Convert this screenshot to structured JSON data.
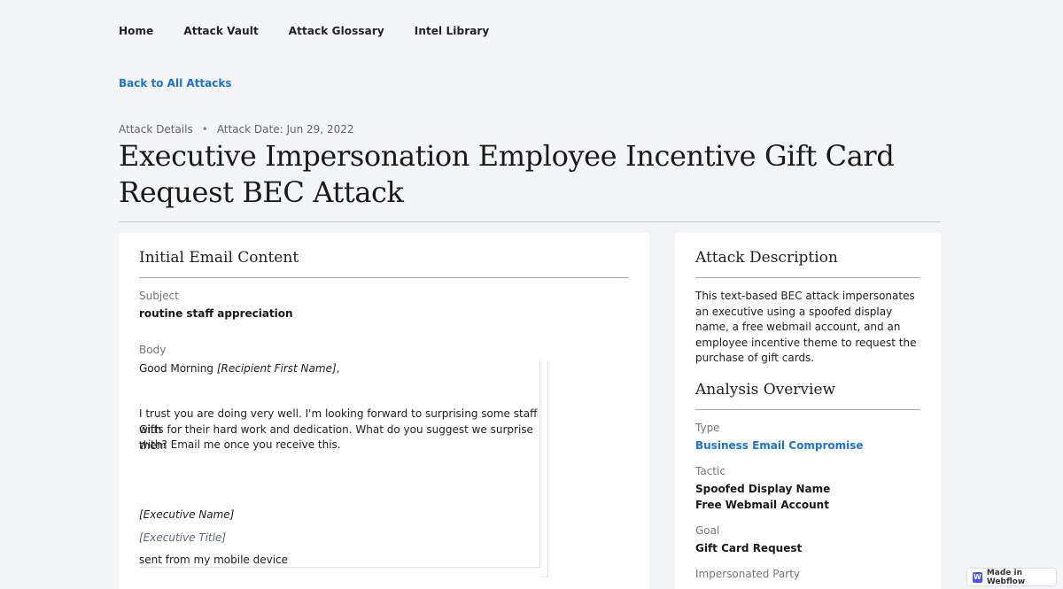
{
  "nav": {
    "items": [
      {
        "label": "Home"
      },
      {
        "label": "Attack Vault"
      },
      {
        "label": "Attack Glossary"
      },
      {
        "label": "Intel Library"
      }
    ]
  },
  "back_link": "Back to All Attacks",
  "meta": {
    "section": "Attack Details",
    "separator": "•",
    "date": "Attack Date: Jun 29, 2022"
  },
  "title": "Executive Impersonation Employee Incentive Gift Card Request BEC Attack",
  "email_card": {
    "heading": "Initial Email Content",
    "subject_label": "Subject",
    "subject_value": "routine staff appreciation",
    "body_label": "Body",
    "greeting_prefix": "Good Morning ",
    "greeting_placeholder": "[Recipient First Name]",
    "greeting_suffix": ",",
    "body_line1": "I trust you are doing very well. I'm looking forward to surprising some staff with",
    "body_line2": "Gifts for their hard work and dedication. What do you suggest we surprise them",
    "body_line3": "with? Email me once you receive this.",
    "signature_name": "[Executive Name]",
    "signature_title": "[Executive Title]",
    "signature_footer": "sent from my mobile device"
  },
  "side_card": {
    "description_heading": "Attack Description",
    "description_text": "This text-based BEC attack impersonates an executive using a spoofed display name, a free webmail account, and an employee incentive theme to request the purchase of gift cards.",
    "overview_heading": "Analysis Overview",
    "type_label": "Type",
    "type_value": "Business Email Compromise",
    "tactic_label": "Tactic",
    "tactic_values": [
      "Spoofed Display Name",
      "Free Webmail Account"
    ],
    "goal_label": "Goal",
    "goal_value": "Gift Card Request",
    "impersonated_label": "Impersonated Party"
  },
  "badge": {
    "icon": "webflow-icon",
    "label": "Made in Webflow"
  },
  "colors": {
    "accent": "#1a73d9",
    "background": "#f4f5f7"
  }
}
